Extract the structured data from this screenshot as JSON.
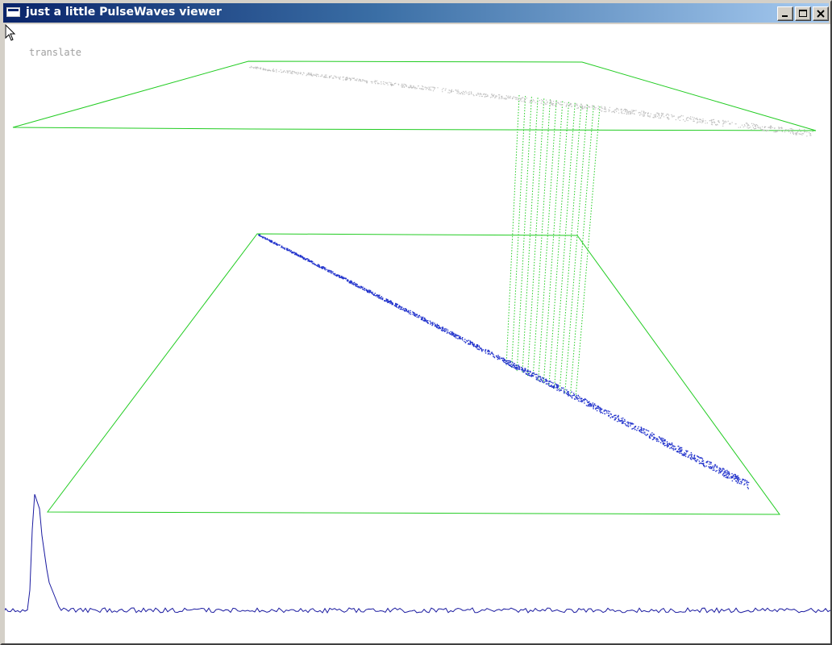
{
  "window": {
    "title": "just a little PulseWaves viewer",
    "controls": {
      "minimize": "minimize",
      "maximize": "maximize",
      "close": "close"
    }
  },
  "viewer": {
    "mode_label": "translate",
    "colors": {
      "background": "#ffffff",
      "bounding_box": "#22cc22",
      "pulse_lines": "#22cc22",
      "points_bottom": "#2233cc",
      "points_top": "#c0c0c0",
      "waveform": "#1a1aa0"
    },
    "icons": [
      "app-icon",
      "minimize-icon",
      "maximize-icon",
      "close-icon",
      "mouse-cursor-icon"
    ]
  }
}
